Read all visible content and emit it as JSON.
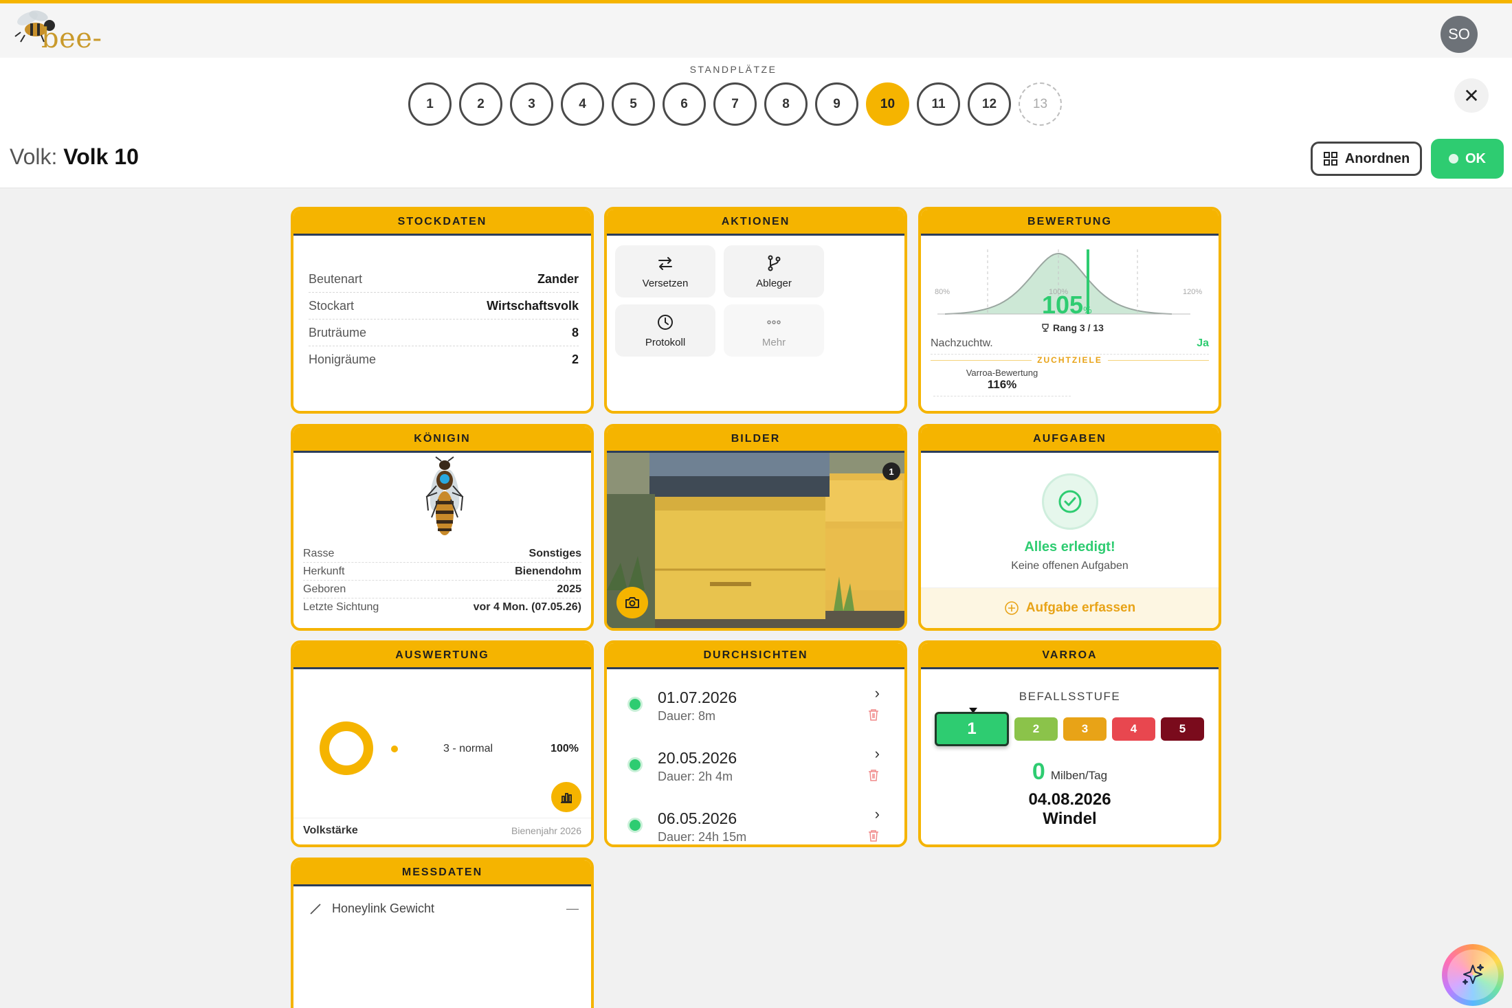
{
  "app": {
    "logo_text": "bee-pilot.io",
    "avatar_initials": "SO"
  },
  "standplaetze": {
    "label": "STANDPLÄTZE",
    "items": [
      "1",
      "2",
      "3",
      "4",
      "5",
      "6",
      "7",
      "8",
      "9",
      "10",
      "11",
      "12",
      "13"
    ],
    "active": "10",
    "ghost": "13"
  },
  "volk": {
    "prefix": "Volk:",
    "name": "Volk 10"
  },
  "toolbar": {
    "anordnen_label": "Anordnen",
    "ok_label": "OK"
  },
  "stockdaten": {
    "title": "STOCKDATEN",
    "rows": [
      {
        "k": "Beutenart",
        "v": "Zander"
      },
      {
        "k": "Stockart",
        "v": "Wirtschaftsvolk"
      },
      {
        "k": "Bruträume",
        "v": "8"
      },
      {
        "k": "Honigräume",
        "v": "2"
      }
    ]
  },
  "aktionen": {
    "title": "AKTIONEN",
    "items": [
      {
        "label": "Versetzen",
        "icon": "swap-arrows-icon"
      },
      {
        "label": "Ableger",
        "icon": "branch-icon"
      },
      {
        "label": "Protokoll",
        "icon": "clock-icon"
      },
      {
        "label": "Mehr",
        "icon": "more-dots-icon"
      }
    ]
  },
  "bewertung": {
    "title": "BEWERTUNG",
    "axis_left": "80%",
    "axis_center": "100%",
    "axis_right": "120%",
    "score": "105",
    "score_unit": "%",
    "rank": "Rang 3 / 13",
    "nachzucht_label": "Nachzuchtw.",
    "nachzucht_value": "Ja",
    "zuchtziele_label": "ZUCHTZIELE",
    "varroa_label": "Varroa-Bewertung",
    "varroa_value": "116%"
  },
  "koenigin": {
    "title": "KÖNIGIN",
    "rows": [
      {
        "k": "Rasse",
        "v": "Sonstiges"
      },
      {
        "k": "Herkunft",
        "v": "Bienendohm"
      },
      {
        "k": "Geboren",
        "v": "2025"
      },
      {
        "k": "Letzte Sichtung",
        "v": "vor 4 Mon. (07.05.26)"
      }
    ],
    "marking_color": "#29a8e0"
  },
  "bilder": {
    "title": "BILDER",
    "count": "1"
  },
  "aufgaben": {
    "title": "AUFGABEN",
    "done_title": "Alles erledigt!",
    "done_sub": "Keine offenen Aufgaben",
    "add_label": "Aufgabe erfassen"
  },
  "auswertung": {
    "title": "AUSWERTUNG",
    "legend_label": "3 - normal",
    "legend_value": "100%",
    "footer_left": "Volkstärke",
    "footer_right": "Bienenjahr 2026"
  },
  "durchsichten": {
    "title": "DURCHSICHTEN",
    "items": [
      {
        "date": "01.07.2026",
        "duration": "Dauer: 8m"
      },
      {
        "date": "20.05.2026",
        "duration": "Dauer: 2h 4m"
      },
      {
        "date": "06.05.2026",
        "duration": "Dauer: 24h 15m"
      }
    ]
  },
  "varroa": {
    "title": "VARROA",
    "befall_label": "BEFALLSSTUFE",
    "levels": [
      {
        "n": "1",
        "color": "#2ecc71"
      },
      {
        "n": "2",
        "color": "#8bc34a"
      },
      {
        "n": "3",
        "color": "#e8a317"
      },
      {
        "n": "4",
        "color": "#e8474f"
      },
      {
        "n": "5",
        "color": "#7a0b1c"
      }
    ],
    "selected": "1",
    "milben_value": "0",
    "milben_unit": "Milben/Tag",
    "date": "04.08.2026",
    "method": "Windel"
  },
  "messdaten": {
    "title": "MESSDATEN",
    "item_label": "Honeylink Gewicht",
    "item_value": "—"
  },
  "colors": {
    "accent": "#f5b400",
    "ok_green": "#2ecc71",
    "dark_blue": "#2b3d5a"
  }
}
